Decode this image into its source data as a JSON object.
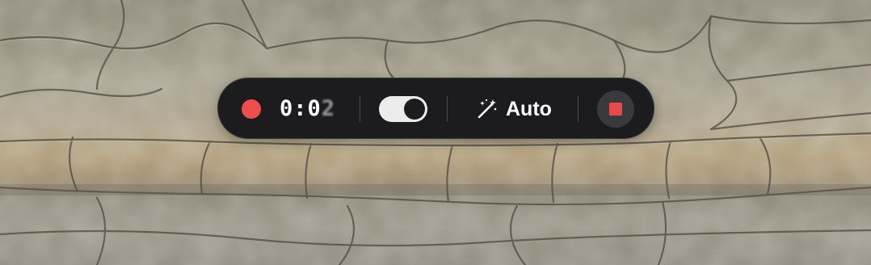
{
  "recorder": {
    "timer_static": "0:0",
    "timer_rolling_digit": "2",
    "toggle_on": true,
    "mode_label": "Auto",
    "icons": {
      "record": "record-dot-icon",
      "mode": "magic-wand-icon",
      "stop": "stop-icon"
    },
    "colors": {
      "pill_background": "#1c1c1e",
      "record_red": "#ee4d4d",
      "stop_red": "#e64a4a",
      "toggle_track": "#ececec"
    }
  }
}
